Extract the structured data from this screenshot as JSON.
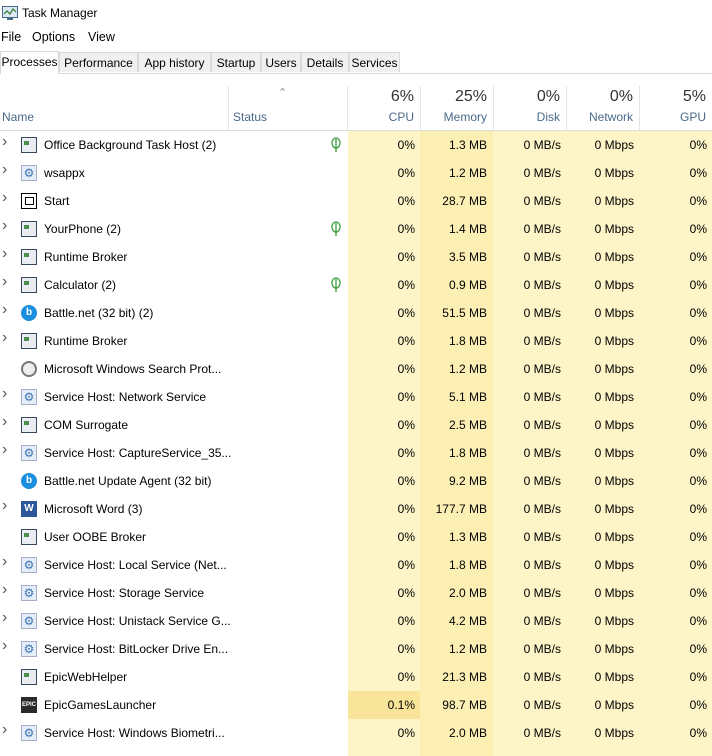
{
  "window": {
    "title": "Task Manager"
  },
  "menu": [
    "File",
    "Options",
    "View"
  ],
  "tabs": [
    "Processes",
    "Performance",
    "App history",
    "Startup",
    "Users",
    "Details",
    "Services"
  ],
  "header": {
    "name": "Name",
    "status": "Status",
    "columns": [
      {
        "pct": "6%",
        "label": "CPU"
      },
      {
        "pct": "25%",
        "label": "Memory"
      },
      {
        "pct": "0%",
        "label": "Disk"
      },
      {
        "pct": "0%",
        "label": "Network"
      },
      {
        "pct": "5%",
        "label": "GPU"
      }
    ]
  },
  "colors": {
    "tint_light": "#fdf4c7",
    "tint_mid": "#fcefb4",
    "cpu_highlight": "#f9e59a",
    "leaf": "#3c9c3c"
  },
  "rows": [
    {
      "name": "Office Background Task Host (2)",
      "icon": "window-icon",
      "expand": true,
      "leaf": true,
      "cpu": "0%",
      "mem": "1.3 MB",
      "disk": "0 MB/s",
      "net": "0 Mbps",
      "gpu": "0%"
    },
    {
      "name": "wsappx",
      "icon": "gear-icon",
      "expand": true,
      "leaf": false,
      "cpu": "0%",
      "mem": "1.2 MB",
      "disk": "0 MB/s",
      "net": "0 Mbps",
      "gpu": "0%"
    },
    {
      "name": "Start",
      "icon": "start-icon",
      "expand": true,
      "leaf": false,
      "cpu": "0%",
      "mem": "28.7 MB",
      "disk": "0 MB/s",
      "net": "0 Mbps",
      "gpu": "0%"
    },
    {
      "name": "YourPhone (2)",
      "icon": "window-icon",
      "expand": true,
      "leaf": true,
      "cpu": "0%",
      "mem": "1.4 MB",
      "disk": "0 MB/s",
      "net": "0 Mbps",
      "gpu": "0%"
    },
    {
      "name": "Runtime Broker",
      "icon": "window-icon",
      "expand": true,
      "leaf": false,
      "cpu": "0%",
      "mem": "3.5 MB",
      "disk": "0 MB/s",
      "net": "0 Mbps",
      "gpu": "0%"
    },
    {
      "name": "Calculator (2)",
      "icon": "window-icon",
      "expand": true,
      "leaf": true,
      "cpu": "0%",
      "mem": "0.9 MB",
      "disk": "0 MB/s",
      "net": "0 Mbps",
      "gpu": "0%"
    },
    {
      "name": "Battle.net (32 bit) (2)",
      "icon": "battlenet-icon",
      "expand": true,
      "leaf": false,
      "cpu": "0%",
      "mem": "51.5 MB",
      "disk": "0 MB/s",
      "net": "0 Mbps",
      "gpu": "0%"
    },
    {
      "name": "Runtime Broker",
      "icon": "window-icon",
      "expand": true,
      "leaf": false,
      "cpu": "0%",
      "mem": "1.8 MB",
      "disk": "0 MB/s",
      "net": "0 Mbps",
      "gpu": "0%"
    },
    {
      "name": "Microsoft Windows Search Prot...",
      "icon": "search-icon",
      "expand": false,
      "leaf": false,
      "cpu": "0%",
      "mem": "1.2 MB",
      "disk": "0 MB/s",
      "net": "0 Mbps",
      "gpu": "0%"
    },
    {
      "name": "Service Host: Network Service",
      "icon": "gear-icon",
      "expand": true,
      "leaf": false,
      "cpu": "0%",
      "mem": "5.1 MB",
      "disk": "0 MB/s",
      "net": "0 Mbps",
      "gpu": "0%"
    },
    {
      "name": "COM Surrogate",
      "icon": "window-icon",
      "expand": true,
      "leaf": false,
      "cpu": "0%",
      "mem": "2.5 MB",
      "disk": "0 MB/s",
      "net": "0 Mbps",
      "gpu": "0%"
    },
    {
      "name": "Service Host: CaptureService_35...",
      "icon": "gear-icon",
      "expand": true,
      "leaf": false,
      "cpu": "0%",
      "mem": "1.8 MB",
      "disk": "0 MB/s",
      "net": "0 Mbps",
      "gpu": "0%"
    },
    {
      "name": "Battle.net Update Agent (32 bit)",
      "icon": "battlenet-icon",
      "expand": false,
      "leaf": false,
      "cpu": "0%",
      "mem": "9.2 MB",
      "disk": "0 MB/s",
      "net": "0 Mbps",
      "gpu": "0%"
    },
    {
      "name": "Microsoft Word (3)",
      "icon": "word-icon",
      "expand": true,
      "leaf": false,
      "cpu": "0%",
      "mem": "177.7 MB",
      "disk": "0 MB/s",
      "net": "0 Mbps",
      "gpu": "0%"
    },
    {
      "name": "User OOBE Broker",
      "icon": "window-icon",
      "expand": false,
      "leaf": false,
      "cpu": "0%",
      "mem": "1.3 MB",
      "disk": "0 MB/s",
      "net": "0 Mbps",
      "gpu": "0%"
    },
    {
      "name": "Service Host: Local Service (Net...",
      "icon": "gear-icon",
      "expand": true,
      "leaf": false,
      "cpu": "0%",
      "mem": "1.8 MB",
      "disk": "0 MB/s",
      "net": "0 Mbps",
      "gpu": "0%"
    },
    {
      "name": "Service Host: Storage Service",
      "icon": "gear-icon",
      "expand": true,
      "leaf": false,
      "cpu": "0%",
      "mem": "2.0 MB",
      "disk": "0 MB/s",
      "net": "0 Mbps",
      "gpu": "0%"
    },
    {
      "name": "Service Host: Unistack Service G...",
      "icon": "gear-icon",
      "expand": true,
      "leaf": false,
      "cpu": "0%",
      "mem": "4.2 MB",
      "disk": "0 MB/s",
      "net": "0 Mbps",
      "gpu": "0%"
    },
    {
      "name": "Service Host: BitLocker Drive En...",
      "icon": "gear-icon",
      "expand": true,
      "leaf": false,
      "cpu": "0%",
      "mem": "1.2 MB",
      "disk": "0 MB/s",
      "net": "0 Mbps",
      "gpu": "0%"
    },
    {
      "name": "EpicWebHelper",
      "icon": "window-icon",
      "expand": false,
      "leaf": false,
      "cpu": "0%",
      "mem": "21.3 MB",
      "disk": "0 MB/s",
      "net": "0 Mbps",
      "gpu": "0%"
    },
    {
      "name": "EpicGamesLauncher",
      "icon": "epic-icon",
      "expand": false,
      "leaf": false,
      "cpu": "0.1%",
      "cpu_high": true,
      "mem": "98.7 MB",
      "disk": "0 MB/s",
      "net": "0 Mbps",
      "gpu": "0%"
    },
    {
      "name": "Service Host: Windows Biometri...",
      "icon": "gear-icon",
      "expand": true,
      "leaf": false,
      "cpu": "0%",
      "mem": "2.0 MB",
      "disk": "0 MB/s",
      "net": "0 Mbps",
      "gpu": "0%"
    }
  ]
}
